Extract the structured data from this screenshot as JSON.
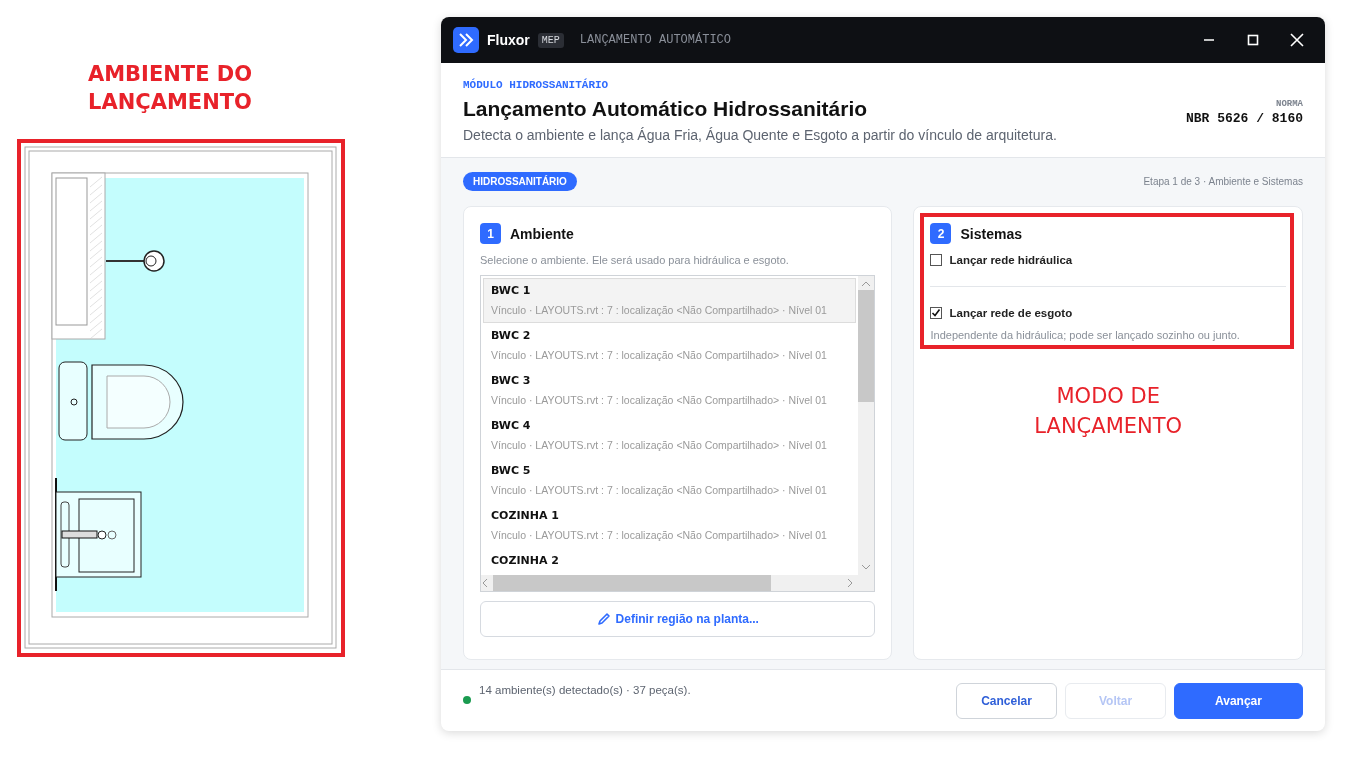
{
  "annotations": {
    "plan_label": "AMBIENTE DO LANÇAMENTO",
    "systems_label": "MODO DE LANÇAMENTO"
  },
  "window": {
    "app": "Fluxor",
    "badge": "MEP",
    "title": "LANÇAMENTO AUTOMÁTICO"
  },
  "header": {
    "eyebrow": "MÓDULO HIDROSSANITÁRIO",
    "title": "Lançamento Automático Hidrossanitário",
    "subtitle": "Detecta o ambiente e lança Água Fria, Água Quente e Esgoto a partir do vínculo de arquitetura.",
    "norm_label": "NORMA",
    "norm_value": "NBR 5626 / 8160"
  },
  "tag": "HIDROSSANITÁRIO",
  "step": "Etapa 1 de 3 · Ambiente e Sistemas",
  "ambiente": {
    "number": "1",
    "title": "Ambiente",
    "hint": "Selecione o ambiente. Ele será usado para hidráulica e esgoto.",
    "rooms": [
      {
        "name": "BWC 1",
        "detail": "Vínculo · LAYOUTS.rvt : 7 : localização <Não Compartilhado>  · Nível  01",
        "selected": true
      },
      {
        "name": "BWC 2",
        "detail": "Vínculo · LAYOUTS.rvt : 7 : localização <Não Compartilhado>  · Nível  01",
        "selected": false
      },
      {
        "name": "BWC 3",
        "detail": "Vínculo · LAYOUTS.rvt : 7 : localização <Não Compartilhado>  · Nível  01",
        "selected": false
      },
      {
        "name": "BWC 4",
        "detail": "Vínculo · LAYOUTS.rvt : 7 : localização <Não Compartilhado>  · Nível  01",
        "selected": false
      },
      {
        "name": "BWC 5",
        "detail": "Vínculo · LAYOUTS.rvt : 7 : localização <Não Compartilhado>  · Nível  01",
        "selected": false
      },
      {
        "name": "COZINHA 1",
        "detail": "Vínculo · LAYOUTS.rvt : 7 : localização <Não Compartilhado>  · Nível  01",
        "selected": false
      },
      {
        "name": "COZINHA 2",
        "selected": false
      }
    ],
    "region_button": "Definir região na planta..."
  },
  "sistemas": {
    "number": "2",
    "title": "Sistemas",
    "options": [
      {
        "label": "Lançar rede hidráulica",
        "checked": false
      },
      {
        "label": "Lançar rede de esgoto",
        "checked": true,
        "note": "Independente da hidráulica; pode ser lançado sozinho ou junto."
      }
    ]
  },
  "footer": {
    "status": "14 ambiente(s) detectado(s) · 37 peça(s).",
    "buttons": [
      {
        "label": "Cancelar",
        "kind": "outline",
        "disabled": false
      },
      {
        "label": "Voltar",
        "kind": "outline",
        "disabled": true
      },
      {
        "label": "Avançar",
        "kind": "primary",
        "disabled": false
      }
    ]
  }
}
